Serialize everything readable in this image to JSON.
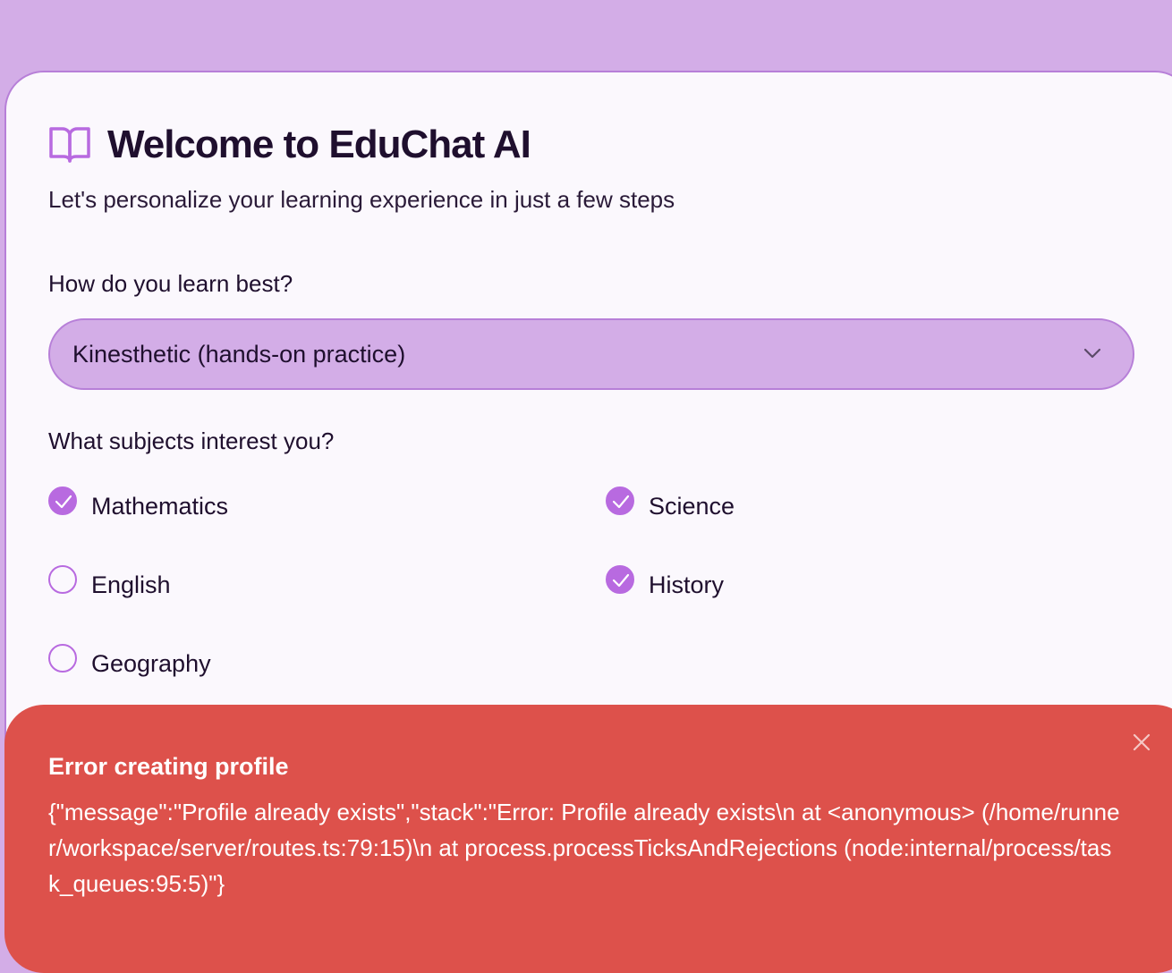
{
  "header": {
    "title": "Welcome to EduChat AI",
    "subtitle": "Let's personalize your learning experience in just a few steps"
  },
  "learning_style": {
    "label": "How do you learn best?",
    "selected": "Kinesthetic (hands-on practice)"
  },
  "subjects": {
    "label": "What subjects interest you?",
    "items": [
      {
        "label": "Mathematics",
        "checked": true
      },
      {
        "label": "Science",
        "checked": true
      },
      {
        "label": "English",
        "checked": false
      },
      {
        "label": "History",
        "checked": true
      },
      {
        "label": "Geography",
        "checked": false
      }
    ]
  },
  "toast": {
    "title": "Error creating profile",
    "message": "{\"message\":\"Profile already exists\",\"stack\":\"Error: Profile already exists\\n at <anonymous> (/home/runner/workspace/server/routes.ts:79:15)\\n at process.processTicksAndRejections (node:internal/process/task_queues:95:5)\"}"
  },
  "colors": {
    "background": "#d3ade7",
    "accent": "#b86ae0",
    "error": "#dd514b"
  }
}
